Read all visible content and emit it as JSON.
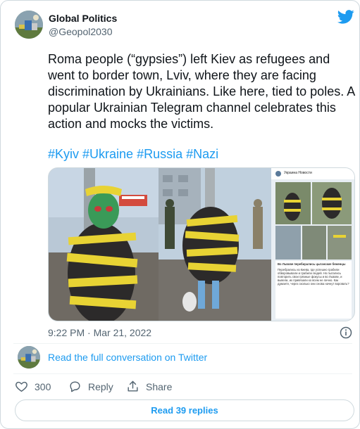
{
  "author": {
    "display_name": "Global Politics",
    "handle": "@Geopol2030"
  },
  "tweet": {
    "text": "Roma people (“gypsies”) left Kiev as refugees and went to border town, Lviv, where they are facing discrimination by Ukrainians. Like here, tied to poles. A popular Ukrainian Telegram channel celebrates this action and mocks the victims.",
    "hashtags": [
      "#Kyiv",
      "#Ukraine",
      "#Russia",
      "#Nazi"
    ],
    "timestamp": "9:22 PM · Mar 21, 2022"
  },
  "media": {
    "telegram_channel_title": "Украина Новости",
    "telegram_post_heading": "Во Львове перебирались цыганские беженцы",
    "telegram_post_body": "Перебрались из Киева, где успешно грабили обворовывали и грабили людей. Но пытались повторить свои грязные фокусы и во Львове, и вывели, их привязали ко всем не лично. Как думаете, через сколько они снова начнут воровать?"
  },
  "conversation_link": "Read the full conversation on Twitter",
  "actions": {
    "like_count": "300",
    "reply_label": "Reply",
    "share_label": "Share"
  },
  "read_replies_label": "Read 39 replies",
  "colors": {
    "accent": "#1d9bf0",
    "text_primary": "#0f1419",
    "text_secondary": "#536471",
    "border": "#cfd9de"
  },
  "icons": [
    "twitter-bird-icon",
    "info-icon",
    "heart-icon",
    "reply-icon",
    "share-icon"
  ]
}
